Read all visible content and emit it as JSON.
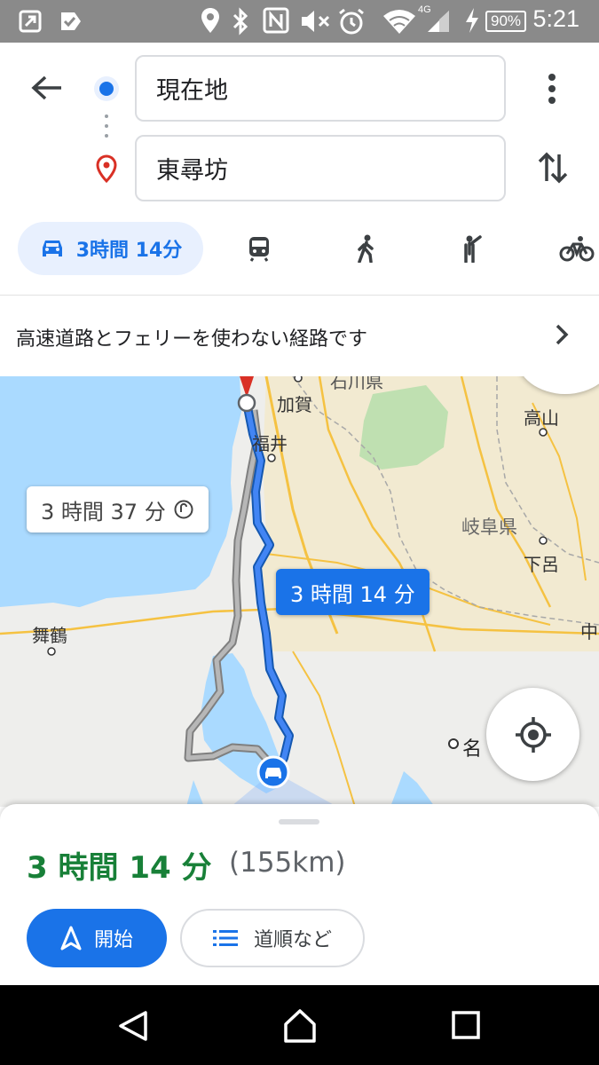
{
  "status_bar": {
    "time": "5:21",
    "battery": "90%",
    "network": "4G"
  },
  "search": {
    "origin": "現在地",
    "destination": "東尋坊"
  },
  "modes": {
    "drive_label": "3時間 14分"
  },
  "notice": {
    "text": "高速道路とフェリーを使わない経路です"
  },
  "map": {
    "labels": {
      "ishikawa": "石川県",
      "kaga": "加賀",
      "takayama": "高山",
      "fukui": "福井",
      "gifu": "岐阜県",
      "gero": "下呂",
      "maizuru": "舞鶴",
      "naka": "中",
      "nagoya": "名"
    },
    "alt_route_time": "3 時間 37 分",
    "main_route_time": "3 時間 14 分"
  },
  "summary": {
    "eta": "3 時間 14 分",
    "distance": "(155km)",
    "start_label": "開始",
    "steps_label": "道順など"
  },
  "colors": {
    "accent": "#1a73e8",
    "eta_green": "#188038",
    "water": "#aadaff",
    "route_alt": "#9e9e9e"
  }
}
